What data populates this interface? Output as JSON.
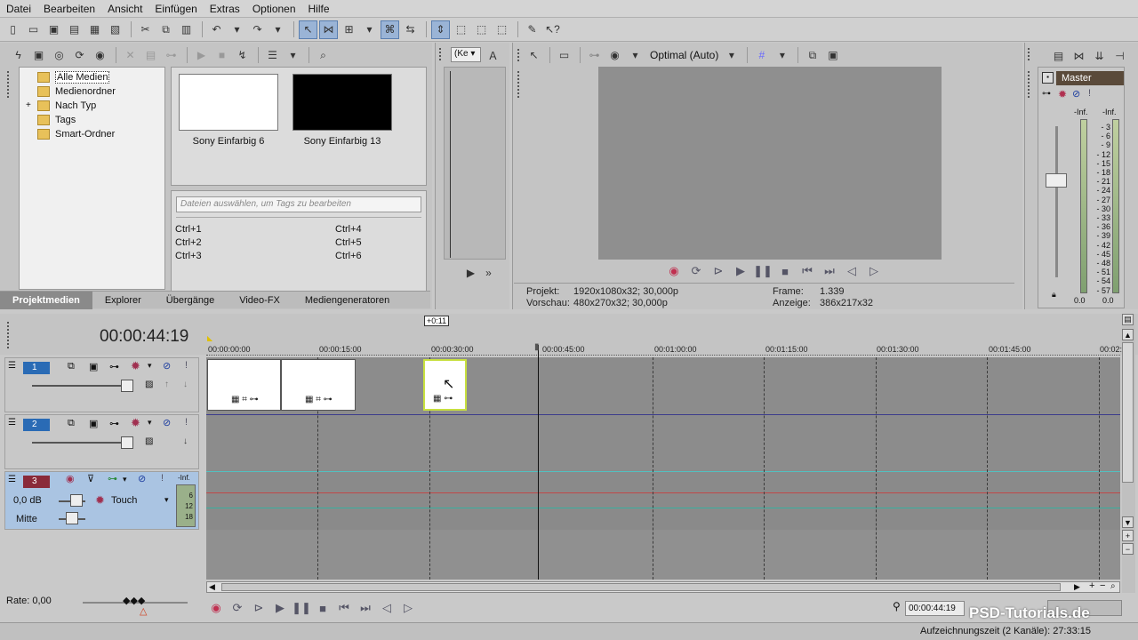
{
  "menu": [
    "Datei",
    "Bearbeiten",
    "Ansicht",
    "Einfügen",
    "Extras",
    "Optionen",
    "Hilfe"
  ],
  "explorer": {
    "tree": [
      "Alle Medien",
      "Medienordner",
      "Nach Typ",
      "Tags",
      "Smart-Ordner"
    ],
    "expand_glyph": "+",
    "media": [
      {
        "label": "Sony Einfarbig 6",
        "color": "#ffffff"
      },
      {
        "label": "Sony Einfarbig 13",
        "color": "#000000"
      }
    ],
    "tag_placeholder": "Dateien auswählen, um Tags zu bearbeiten",
    "hotkeys": [
      "Ctrl+1",
      "Ctrl+4",
      "Ctrl+2",
      "Ctrl+5",
      "Ctrl+3",
      "Ctrl+6"
    ],
    "tabs": [
      "Projektmedien",
      "Explorer",
      "Übergänge",
      "Video-FX",
      "Mediengeneratoren"
    ]
  },
  "trimmer": {
    "dropdown": "(Ke"
  },
  "preview": {
    "quality": "Optimal (Auto)",
    "projekt_label": "Projekt:",
    "projekt_value": "1920x1080x32; 30,000p",
    "vorschau_label": "Vorschau:",
    "vorschau_value": "480x270x32; 30,000p",
    "frame_label": "Frame:",
    "frame_value": "1.339",
    "anzeige_label": "Anzeige:",
    "anzeige_value": "386x217x32"
  },
  "mixer": {
    "master": "Master",
    "inf_left": "-Inf.",
    "inf_right": "-Inf.",
    "scale": [
      "3",
      "6",
      "9",
      "12",
      "15",
      "18",
      "21",
      "24",
      "27",
      "30",
      "33",
      "36",
      "39",
      "42",
      "45",
      "48",
      "51",
      "54",
      "57"
    ],
    "bottom_left": "0.0",
    "bottom_right": "0.0"
  },
  "timeline": {
    "time": "00:00:44:19",
    "offset_badge": "+0:11",
    "ruler": [
      "00:00:00:00",
      "00:00:15:00",
      "00:00:30:00",
      "00:00:45:00",
      "00:01:00:00",
      "00:01:15:00",
      "00:01:30:00",
      "00:01:45:00",
      "00:02:"
    ],
    "tracks": [
      {
        "num": "1",
        "type": "video"
      },
      {
        "num": "2",
        "type": "video"
      },
      {
        "num": "3",
        "type": "audio",
        "db": "0,0 dB",
        "pan": "Mitte",
        "mode": "Touch",
        "inf": "-Inf.",
        "meter": [
          "6",
          "12",
          "18"
        ]
      }
    ]
  },
  "footer": {
    "rate": "Rate: 0,00",
    "timecode": "00:00:44:19",
    "status": "Aufzeichnungszeit (2 Kanäle): 27:33:15",
    "watermark": "PSD-Tutorials.de"
  }
}
